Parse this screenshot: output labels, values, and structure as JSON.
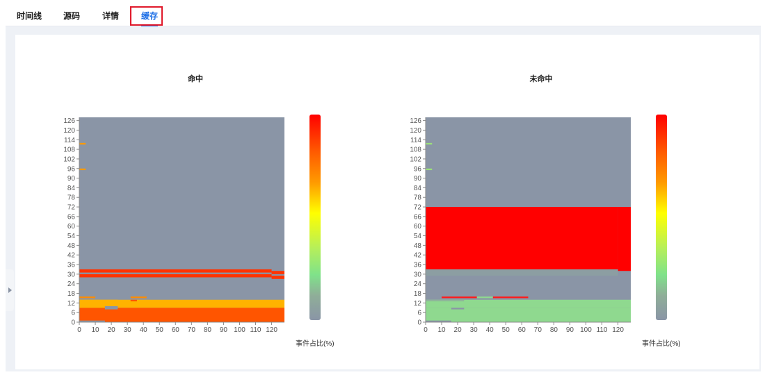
{
  "tabs": [
    {
      "label": "时间线"
    },
    {
      "label": "源码"
    },
    {
      "label": "详情"
    },
    {
      "label": "缓存"
    }
  ],
  "active_tab": "缓存",
  "legend_label": "事件占比(%)",
  "colors": {
    "background_cell": "#8a95a6",
    "accent": "#1e6fe6",
    "highlight_border": "#e0192b"
  },
  "chart_data": [
    {
      "type": "heatmap",
      "title": "命中",
      "xlim": [
        0,
        128
      ],
      "ylim": [
        0,
        128
      ],
      "x_ticks": [
        0,
        10,
        20,
        30,
        40,
        50,
        60,
        70,
        80,
        90,
        100,
        110,
        120
      ],
      "y_ticks": [
        0,
        6,
        12,
        18,
        24,
        30,
        36,
        42,
        48,
        54,
        60,
        66,
        72,
        78,
        84,
        90,
        96,
        102,
        108,
        114,
        120,
        126
      ],
      "colorbar": [
        "#8a95a6",
        "#7fe28a",
        "#ffff00",
        "#ff9a00",
        "#ff0000"
      ],
      "cells": [
        {
          "x0": 0,
          "x1": 128,
          "y0": 0,
          "y1": 128,
          "color": "#8a95a6"
        },
        {
          "x0": 0,
          "x1": 128,
          "y0": 0,
          "y1": 9,
          "color": "#ff5500"
        },
        {
          "x0": 0,
          "x1": 16,
          "y0": 0,
          "y1": 1,
          "color": "#8a95a6"
        },
        {
          "x0": 0,
          "x1": 128,
          "y0": 9,
          "y1": 14,
          "color": "#ffb300"
        },
        {
          "x0": 0,
          "x1": 24,
          "y0": 9,
          "y1": 14,
          "color": "#ffb300"
        },
        {
          "x0": 16,
          "x1": 24,
          "y0": 8,
          "y1": 10,
          "color": "#8a95a6"
        },
        {
          "x0": 0,
          "x1": 10,
          "y0": 15,
          "y1": 16,
          "color": "#ff8c00"
        },
        {
          "x0": 32,
          "x1": 42,
          "y0": 15,
          "y1": 16,
          "color": "#ff8c00"
        },
        {
          "x0": 32,
          "x1": 36,
          "y0": 13,
          "y1": 14,
          "color": "#ff5500"
        },
        {
          "x0": 0,
          "x1": 120,
          "y0": 28,
          "y1": 30,
          "color": "#ff3300"
        },
        {
          "x0": 0,
          "x1": 120,
          "y0": 31,
          "y1": 33,
          "color": "#ff3300"
        },
        {
          "x0": 120,
          "x1": 128,
          "y0": 27,
          "y1": 29,
          "color": "#ff3300"
        },
        {
          "x0": 120,
          "x1": 128,
          "y0": 30,
          "y1": 32,
          "color": "#ff3300"
        },
        {
          "x0": 0,
          "x1": 4,
          "y0": 95,
          "y1": 96,
          "color": "#ff9a00"
        },
        {
          "x0": 0,
          "x1": 4,
          "y0": 111,
          "y1": 112,
          "color": "#ff9a00"
        }
      ]
    },
    {
      "type": "heatmap",
      "title": "未命中",
      "xlim": [
        0,
        128
      ],
      "ylim": [
        0,
        128
      ],
      "x_ticks": [
        0,
        10,
        20,
        30,
        40,
        50,
        60,
        70,
        80,
        90,
        100,
        110,
        120
      ],
      "y_ticks": [
        0,
        6,
        12,
        18,
        24,
        30,
        36,
        42,
        48,
        54,
        60,
        66,
        72,
        78,
        84,
        90,
        96,
        102,
        108,
        114,
        120,
        126
      ],
      "colorbar": [
        "#8a95a6",
        "#7fe28a",
        "#ffff00",
        "#ff9a00",
        "#ff0000"
      ],
      "cells": [
        {
          "x0": 0,
          "x1": 128,
          "y0": 0,
          "y1": 128,
          "color": "#8a95a6"
        },
        {
          "x0": 0,
          "x1": 128,
          "y0": 0,
          "y1": 9,
          "color": "#8fd98f"
        },
        {
          "x0": 0,
          "x1": 16,
          "y0": 0,
          "y1": 1,
          "color": "#8a95a6"
        },
        {
          "x0": 16,
          "x1": 24,
          "y0": 8,
          "y1": 10,
          "color": "#8a95a6"
        },
        {
          "x0": 0,
          "x1": 128,
          "y0": 9,
          "y1": 14,
          "color": "#8fd98f"
        },
        {
          "x0": 0,
          "x1": 24,
          "y0": 13,
          "y1": 14,
          "color": "#8fb59a"
        },
        {
          "x0": 10,
          "x1": 32,
          "y0": 15,
          "y1": 16,
          "color": "#ff1a1a"
        },
        {
          "x0": 32,
          "x1": 42,
          "y0": 15,
          "y1": 16,
          "color": "#8fd98f"
        },
        {
          "x0": 42,
          "x1": 64,
          "y0": 15,
          "y1": 16,
          "color": "#ff1a1a"
        },
        {
          "x0": 0,
          "x1": 120,
          "y0": 33,
          "y1": 72,
          "color": "#ff0000"
        },
        {
          "x0": 120,
          "x1": 128,
          "y0": 32,
          "y1": 72,
          "color": "#ff0000"
        },
        {
          "x0": 0,
          "x1": 120,
          "y0": 29,
          "y1": 33,
          "color": "#8c9ea2"
        },
        {
          "x0": 0,
          "x1": 4,
          "y0": 95,
          "y1": 96,
          "color": "#9be07a"
        },
        {
          "x0": 0,
          "x1": 4,
          "y0": 111,
          "y1": 112,
          "color": "#9be07a"
        }
      ]
    }
  ]
}
